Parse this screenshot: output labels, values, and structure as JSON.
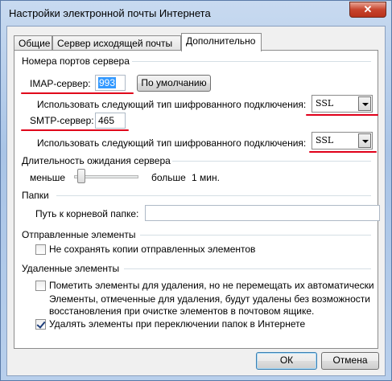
{
  "window": {
    "title": "Настройки электронной почты Интернета",
    "close_label": "✕"
  },
  "tabs": [
    {
      "label": "Общие"
    },
    {
      "label": "Сервер исходящей почты"
    },
    {
      "label": "Дополнительно"
    }
  ],
  "server_ports": {
    "group_title": "Номера портов сервера",
    "imap_label": "IMAP-сервер:",
    "imap_port": "993",
    "default_button": "По умолчанию",
    "imap_encryption_label": "Использовать следующий тип шифрованного подключения:",
    "imap_encryption_value": "SSL",
    "smtp_label": "SMTP-сервер:",
    "smtp_port": "465",
    "smtp_encryption_label": "Использовать следующий тип шифрованного подключения:",
    "smtp_encryption_value": "SSL"
  },
  "timeout": {
    "group_title": "Длительность ожидания сервера",
    "less_label": "меньше",
    "more_label": "больше",
    "value_label": "1 мин.",
    "level": 0.05
  },
  "folders": {
    "group_title": "Папки",
    "root_path_label": "Путь к корневой папке:",
    "root_path_value": ""
  },
  "sent_items": {
    "group_title": "Отправленные элементы",
    "no_copies_label": "Не сохранять копии отправленных элементов",
    "no_copies_checked": false
  },
  "deleted_items": {
    "group_title": "Удаленные элементы",
    "mark_label": "Пометить элементы для удаления, но не перемещать их автоматически",
    "mark_checked": false,
    "note_line1": "Элементы, отмеченные для удаления, будут удалены без возможности",
    "note_line2": "восстановления при очистке элементов в почтовом ящике.",
    "purge_label": "Удалять элементы при переключении папок в Интернете",
    "purge_checked": true
  },
  "footer": {
    "ok_label": "ОК",
    "cancel_label": "Отмена"
  },
  "colors": {
    "annotation_underline": "#e0001a",
    "selection": "#3399ff"
  }
}
